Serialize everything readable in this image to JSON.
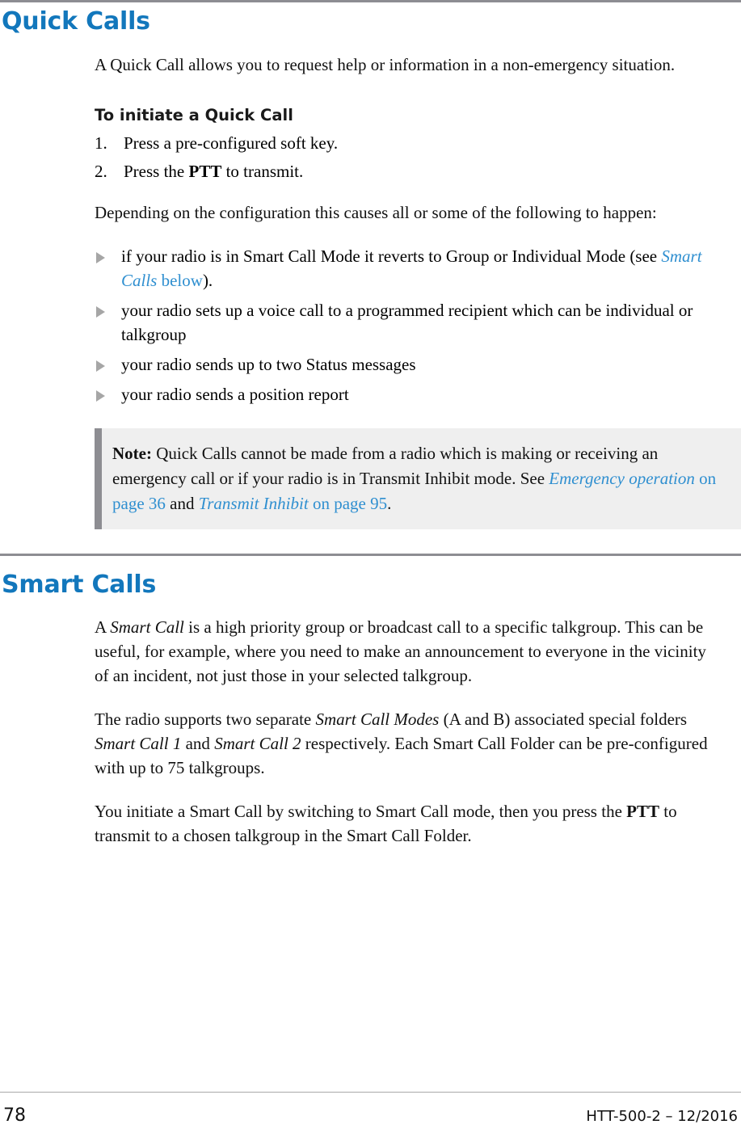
{
  "page": {
    "number": "78",
    "doc_id": "HTT-500-2 – 12/2016"
  },
  "sections": [
    {
      "id": "quick-calls",
      "heading": "Quick Calls",
      "intro": "A Quick Call allows you to request help or information in a non-emergency situation.",
      "subheading": "To initiate a Quick Call",
      "steps": [
        {
          "num": "1.",
          "pre": "Press a pre-configured soft key.",
          "bold": "",
          "post": ""
        },
        {
          "num": "2.",
          "pre": "Press the ",
          "bold": "PTT",
          "post": " to transmit."
        }
      ],
      "lead_in": "Depending on the configuration this causes all or some of the following to happen:",
      "bullets": [
        {
          "pre": "if your radio is in Smart Call Mode it reverts to Group or Individual Mode (see ",
          "link_italic": "Smart Calls",
          "link_plain": " below",
          "post": ")."
        },
        {
          "pre": "your radio sets up a voice call to a programmed recipient which can be individual or talkgroup",
          "link_italic": "",
          "link_plain": "",
          "post": ""
        },
        {
          "pre": "your radio sends up to two Status messages",
          "link_italic": "",
          "link_plain": "",
          "post": ""
        },
        {
          "pre": "your radio sends a position report",
          "link_italic": "",
          "link_plain": "",
          "post": ""
        }
      ],
      "note": {
        "label": "Note:",
        "text_1": " Quick Calls cannot be made from a radio which is making or receiving an emergency call or if your radio is in Transmit Inhibit mode. See ",
        "link_1_italic": "Emergency operation",
        "link_1_plain": " on page 36",
        "text_2": " and ",
        "link_2_italic": "Transmit Inhibit ",
        "link_2_plain": " on page 95",
        "text_3": "."
      }
    },
    {
      "id": "smart-calls",
      "heading": "Smart Calls",
      "para_1": {
        "a": "A ",
        "i1": "Smart Call",
        "b": " is a high priority group or broadcast call to a specific talkgroup. This can be useful, for example, where you need to make an announcement to everyone in the vicinity of an incident, not just those in your selected talkgroup."
      },
      "para_2": {
        "a": "The radio supports two separate ",
        "i1": "Smart Call Modes",
        "b": " (A and B) associated special folders ",
        "i2": "Smart Call 1",
        "c": " and ",
        "i3": "Smart Call 2",
        "d": " respectively. Each Smart Call Folder can be pre-configured with up to 75 talkgroups."
      },
      "para_3": {
        "a": "You initiate a Smart Call by switching to Smart Call mode, then you press the ",
        "bold": "PTT",
        "b": " to transmit to a chosen talkgroup in the Smart Call Folder."
      }
    }
  ],
  "colors": {
    "heading_blue": "#1277bc",
    "link_blue": "#2f8fd0",
    "rule_gray": "#8d8d92",
    "note_bg": "#efefef",
    "bullet_gray": "#a6a6a6"
  }
}
